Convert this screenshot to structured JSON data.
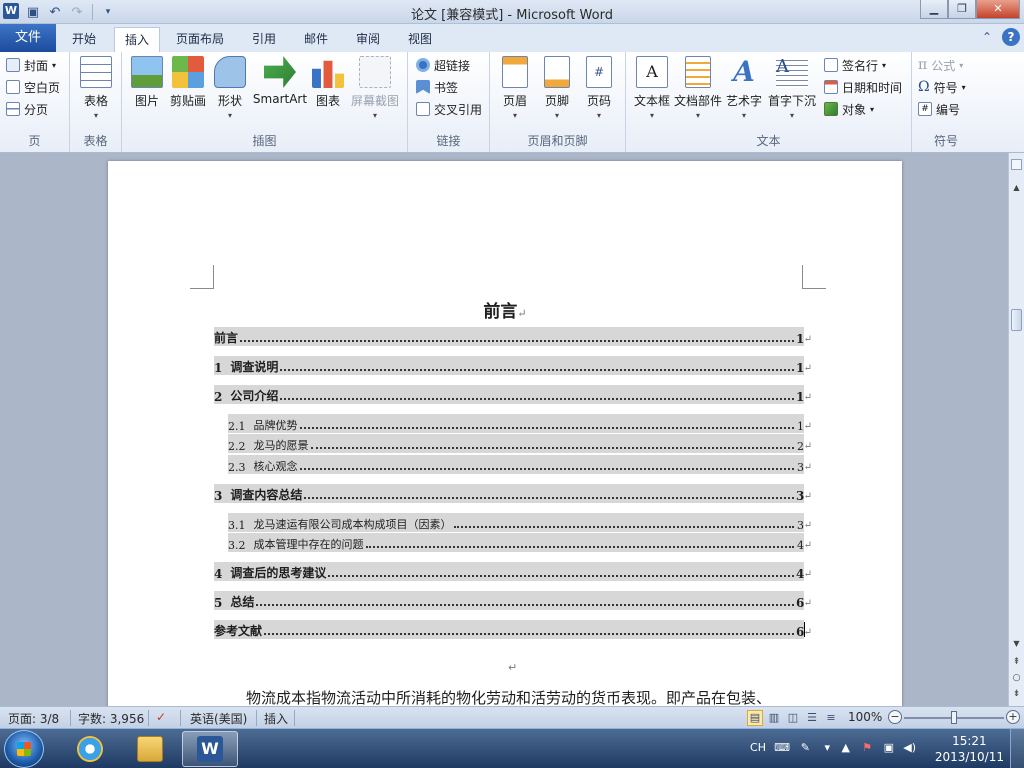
{
  "window": {
    "title": "论文 [兼容模式]  -  Microsoft Word",
    "app_icon_letter": "W",
    "minimize": "▁",
    "maximize": "❐",
    "close": "✕"
  },
  "tabs": [
    {
      "label": "文件"
    },
    {
      "label": "开始"
    },
    {
      "label": "插入",
      "active": true
    },
    {
      "label": "页面布局"
    },
    {
      "label": "引用"
    },
    {
      "label": "邮件"
    },
    {
      "label": "审阅"
    },
    {
      "label": "视图"
    }
  ],
  "ribbon": {
    "page_group": {
      "label": "页",
      "cover": "封面",
      "blank": "空白页",
      "break": "分页"
    },
    "table_group": {
      "label": "表格",
      "table": "表格"
    },
    "illustrations_group": {
      "label": "插图",
      "picture": "图片",
      "clipart": "剪贴画",
      "shapes": "形状",
      "smartart": "SmartArt",
      "chart": "图表",
      "screenshot": "屏幕截图"
    },
    "links_group": {
      "label": "链接",
      "hyperlink": "超链接",
      "bookmark": "书签",
      "crossref": "交叉引用"
    },
    "header_footer_group": {
      "label": "页眉和页脚",
      "header": "页眉",
      "footer": "页脚",
      "pagenum": "页码"
    },
    "text_group": {
      "label": "文本",
      "textbox": "文本框",
      "quickparts": "文档部件",
      "wordart": "艺术字",
      "dropcap": "首字下沉",
      "signature": "签名行",
      "datetime": "日期和时间",
      "object": "对象"
    },
    "symbols_group": {
      "label": "符号",
      "equation": "公式",
      "symbol": "符号",
      "number": "编号"
    }
  },
  "document": {
    "title": "前言",
    "toc": [
      {
        "level": 1,
        "num": "",
        "text": "前言",
        "page": "1"
      },
      {
        "level": 1,
        "num": "1",
        "text": "调查说明",
        "page": "1"
      },
      {
        "level": 1,
        "num": "2",
        "text": "公司介绍",
        "page": "1"
      },
      {
        "level": 2,
        "num": "2.1",
        "text": "品牌优势",
        "page": "1"
      },
      {
        "level": 2,
        "num": "2.2",
        "text": "龙马的愿景",
        "page": "2"
      },
      {
        "level": 2,
        "num": "2.3",
        "text": "核心观念",
        "page": "3"
      },
      {
        "level": 1,
        "num": "3",
        "text": "调查内容总结",
        "page": "3"
      },
      {
        "level": 2,
        "num": "3.1",
        "text": "龙马速运有限公司成本构成项目（因素）",
        "page": "3"
      },
      {
        "level": 2,
        "num": "3.2",
        "text": "成本管理中存在的问题",
        "page": "4"
      },
      {
        "level": 1,
        "num": "4",
        "text": "调查后的思考建议",
        "page": "4"
      },
      {
        "level": 1,
        "num": "5",
        "text": "总结",
        "page": "6"
      },
      {
        "level": 1,
        "num": "",
        "text": "参考文献",
        "page": "6"
      }
    ],
    "body_line": "物流成本指物流活动中所消耗的物化劳动和活劳动的货币表现。即产品在包装、",
    "paragraph_mark": "↵"
  },
  "statusbar": {
    "page": "页面: 3/8",
    "words": "字数: 3,956",
    "language": "英语(美国)",
    "mode": "插入",
    "zoom": "100%",
    "zoom_level": 1.0
  },
  "taskbar": {
    "lang": "CH",
    "time": "15:21",
    "date": "2013/10/11"
  },
  "colors": {
    "file_tab": "#1c4b9c",
    "toc_highlight": "#d7d7d7",
    "word_blue": "#2b5797"
  }
}
